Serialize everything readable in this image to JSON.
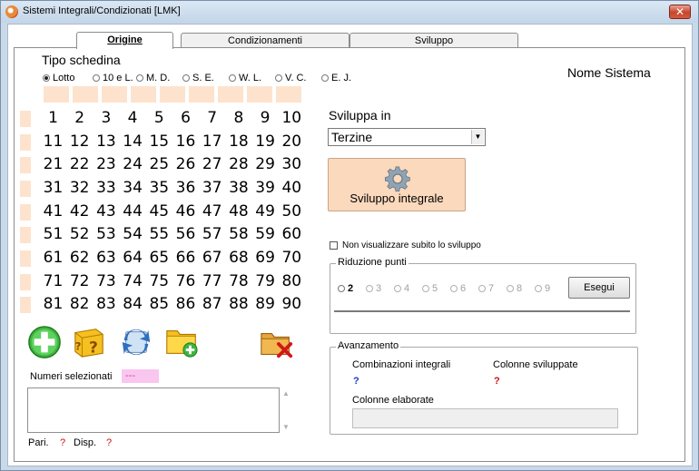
{
  "window": {
    "title": "Sistemi Integrali/Condizionati  [LMK]",
    "close_label": "✕"
  },
  "tabs": [
    {
      "label": "Origine",
      "active": true
    },
    {
      "label": "Condizionamenti",
      "active": false
    },
    {
      "label": "Sviluppo",
      "active": false
    }
  ],
  "tipo_schedina": {
    "label": "Tipo schedina",
    "options": [
      {
        "label": "Lotto",
        "selected": true
      },
      {
        "label": "10 e L.",
        "selected": false
      },
      {
        "label": "M. D.",
        "selected": false
      },
      {
        "label": "S. E.",
        "selected": false
      },
      {
        "label": "W. L.",
        "selected": false
      },
      {
        "label": "V. C.",
        "selected": false
      },
      {
        "label": "E. J.",
        "selected": false
      }
    ]
  },
  "nome_sistema": "Nome Sistema",
  "numbers": [
    [
      "1",
      "2",
      "3",
      "4",
      "5",
      "6",
      "7",
      "8",
      "9",
      "10"
    ],
    [
      "11",
      "12",
      "13",
      "14",
      "15",
      "16",
      "17",
      "18",
      "19",
      "20"
    ],
    [
      "21",
      "22",
      "23",
      "24",
      "25",
      "26",
      "27",
      "28",
      "29",
      "30"
    ],
    [
      "31",
      "32",
      "33",
      "34",
      "35",
      "36",
      "37",
      "38",
      "39",
      "40"
    ],
    [
      "41",
      "42",
      "43",
      "44",
      "45",
      "46",
      "47",
      "48",
      "49",
      "50"
    ],
    [
      "51",
      "52",
      "53",
      "54",
      "55",
      "56",
      "57",
      "58",
      "59",
      "60"
    ],
    [
      "61",
      "62",
      "63",
      "64",
      "65",
      "66",
      "67",
      "68",
      "69",
      "70"
    ],
    [
      "71",
      "72",
      "73",
      "74",
      "75",
      "76",
      "77",
      "78",
      "79",
      "80"
    ],
    [
      "81",
      "82",
      "83",
      "84",
      "85",
      "86",
      "87",
      "88",
      "89",
      "90"
    ]
  ],
  "sviluppa": {
    "label": "Sviluppa in",
    "selected": "Terzine",
    "button_label": "Sviluppo integrale"
  },
  "non_visualizzare": "Non visualizzare subito lo sviluppo",
  "riduzione": {
    "title": "Riduzione punti",
    "options": [
      "2",
      "3",
      "4",
      "5",
      "6",
      "7",
      "8",
      "9"
    ],
    "button": "Esegui"
  },
  "avanzamento": {
    "title": "Avanzamento",
    "combinazioni_label": "Combinazioni integrali",
    "combinazioni_value": "?",
    "colonne_sviluppate_label": "Colonne sviluppate",
    "colonne_sviluppate_value": "?",
    "colonne_elaborate_label": "Colonne elaborate"
  },
  "numeri_selezionati": {
    "label": "Numeri selezionati",
    "value": "---"
  },
  "stats": {
    "pari_label": "Pari.",
    "pari_value": "?",
    "disp_label": "Disp.",
    "disp_value": "?"
  },
  "colors": {
    "peach": "#fde3cd",
    "button_peach": "#fbd9bd",
    "pink": "#f9c6ef",
    "blue_q": "#1a3cc8",
    "red_q": "#d01010"
  }
}
